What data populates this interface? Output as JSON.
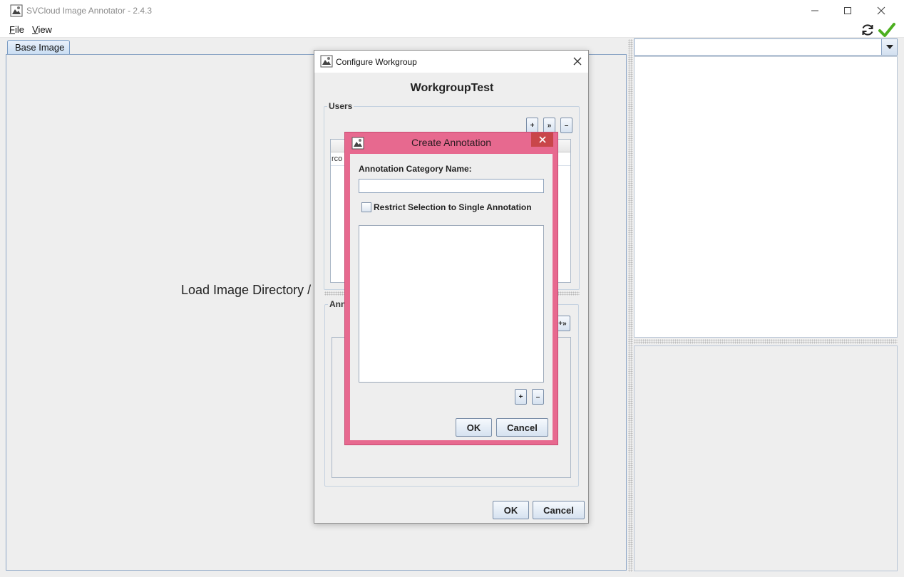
{
  "window": {
    "title": "SVCloud Image Annotator - 2.4.3"
  },
  "menu": {
    "file_underline": "F",
    "file_rest": "ile",
    "view_underline": "V",
    "view_rest": "iew"
  },
  "toolbar_icons": [
    "sync-icon",
    "checkmark-icon"
  ],
  "left_panel": {
    "tab_label": "Base Image",
    "placeholder_text": "Load Image Directory / C"
  },
  "configure_dialog": {
    "title": "Configure Workgroup",
    "heading": "WorkgroupTest",
    "users_group_label": "Users",
    "users_buttons": [
      "+",
      "»",
      "–"
    ],
    "users_rows": [
      "rco"
    ],
    "annotations_group_label": "Ann",
    "annotations_button": "+»",
    "ok_label": "OK",
    "cancel_label": "Cancel"
  },
  "create_dialog": {
    "title": "Create Annotation",
    "category_label": "Annotation Category Name:",
    "category_value": "",
    "restrict_label": "Restrict Selection to Single Annotation",
    "restrict_checked": false,
    "list_items": [],
    "add_label": "+",
    "remove_label": "–",
    "ok_label": "OK",
    "cancel_label": "Cancel"
  },
  "colors": {
    "active_dialog_frame": "#e7698f",
    "close_button": "#c9464a",
    "check_green": "#4caf1f",
    "panel_border": "#8da6c6"
  }
}
